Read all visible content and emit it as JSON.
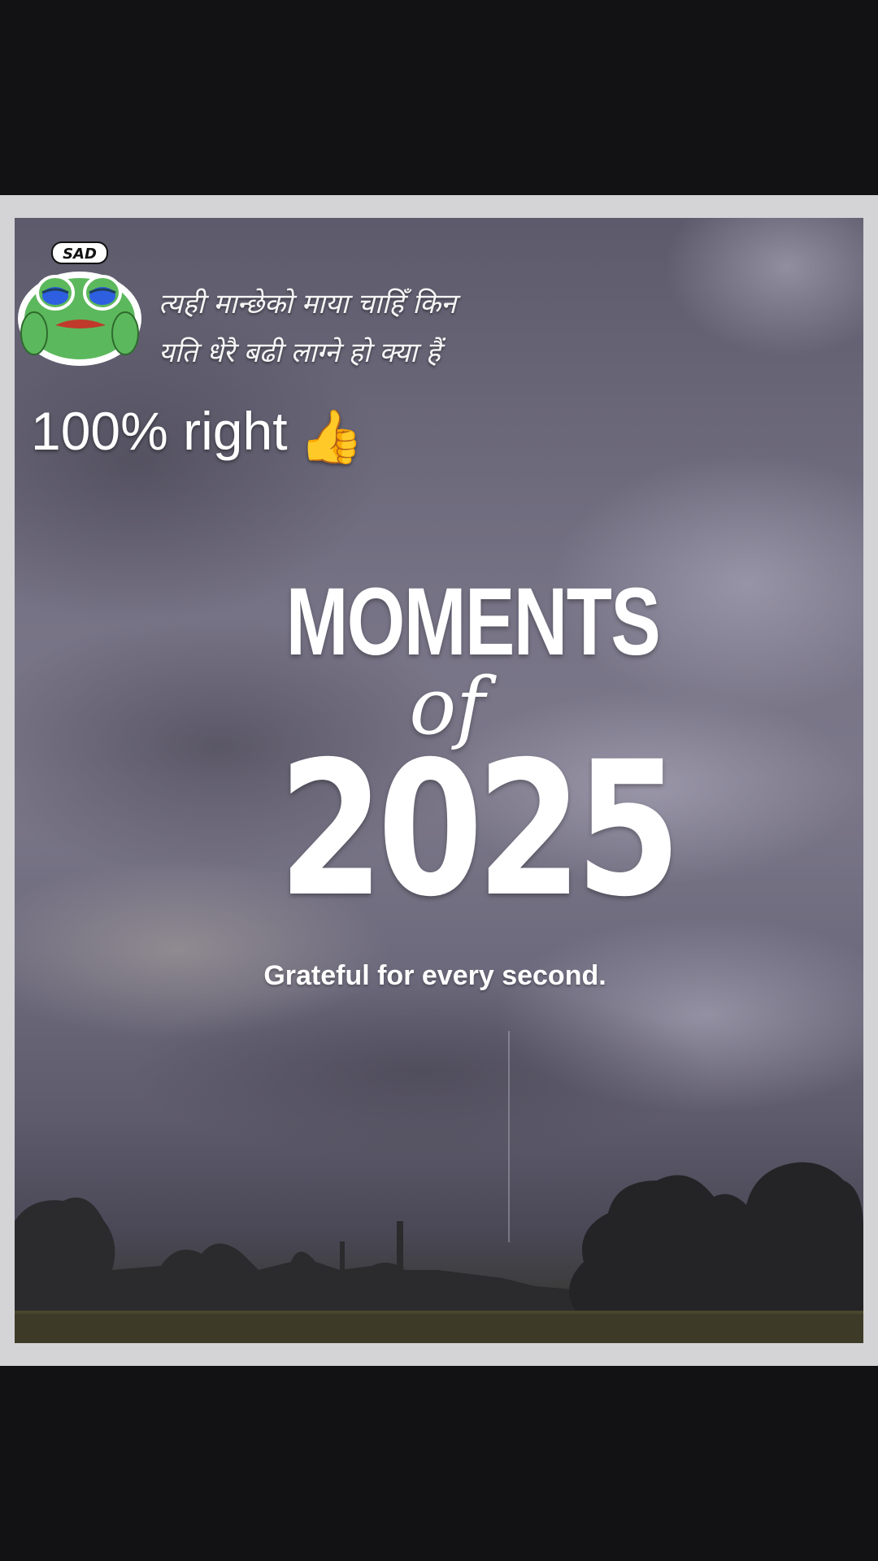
{
  "sticker": {
    "label": "SAD",
    "icon": "sad-frog-icon"
  },
  "nepali_text": {
    "line1": "त्यही मान्छेको माया चाहिँ किन",
    "line2": "यति धेरै बढी लाग्ने हो क्या हैं"
  },
  "caption": {
    "text": "100% right",
    "emoji": "👍"
  },
  "title": {
    "moments": "MOMENTS",
    "of": "of",
    "year": "2025"
  },
  "subtitle": "Grateful for every second.",
  "colors": {
    "background": "#121113",
    "frame": "#d4d3d6",
    "sky": "#757185",
    "text": "#ffffff",
    "frog_green": "#5cb85c",
    "frog_eye_blue": "#2d5fe0"
  }
}
